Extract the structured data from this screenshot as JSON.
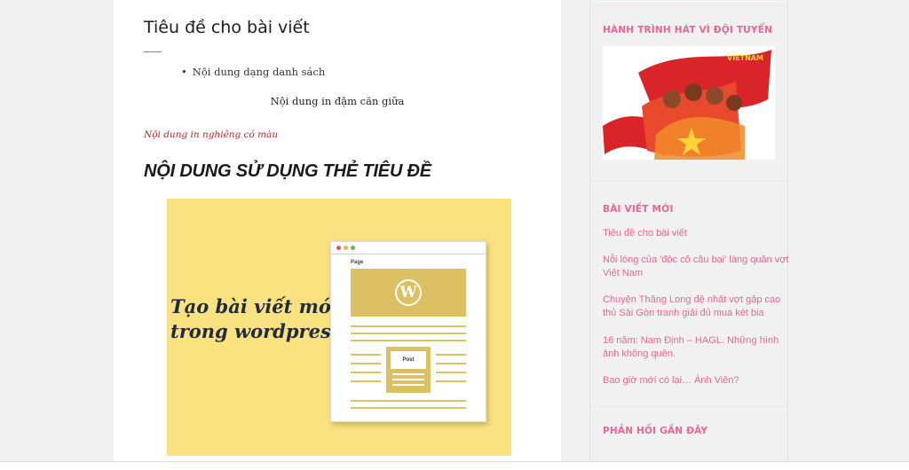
{
  "post": {
    "title": "Tiêu đề cho bài viết",
    "list_item": "Nội dung dạng danh sách",
    "bold_center": "Nội dung in đậm căn giữa",
    "italic_colored": "Nội dung in nghiêng có màu",
    "heading": "NỘI DUNG SỬ DỤNG THẺ TIÊU ĐỀ",
    "image": {
      "line1": "Tạo bài viết mới",
      "line2": "trong wordpres",
      "page_label": "Page",
      "post_label": "Post",
      "logo": "W"
    }
  },
  "sidebar": {
    "widget1_title": "HÀNH TRÌNH HÁT VÌ ĐỘI TUYỂN",
    "recent_title": "BÀI VIẾT MỚI",
    "recent_posts": [
      "Tiêu đề cho bài viết",
      "Nỗi lòng của 'độc cô cầu bại' làng quần vợt Việt Nam",
      "Chuyện Thăng Long đệ nhất vợt gặp cao thủ Sài Gòn tranh giải đủ mua két bia",
      "16 năm: Nam Định – HAGL. Những hình ảnh không quên.",
      "Bao giờ mới có lại… Ánh Viên?"
    ],
    "comments_title": "PHẢN HỒI GẦN ĐÂY"
  },
  "colors": {
    "accent": "#e46897",
    "italic_red": "#b3292a",
    "banner_yellow": "#fbe281"
  }
}
